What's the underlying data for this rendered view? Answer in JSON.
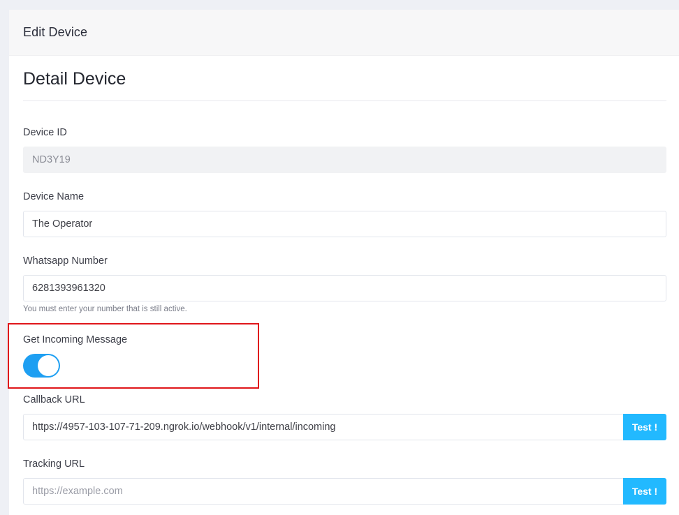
{
  "header": {
    "title": "Edit Device"
  },
  "section": {
    "title": "Detail Device"
  },
  "fields": {
    "device_id": {
      "label": "Device ID",
      "value": "ND3Y19"
    },
    "device_name": {
      "label": "Device Name",
      "value": "The Operator"
    },
    "whatsapp_number": {
      "label": "Whatsapp Number",
      "value": "6281393961320",
      "help": "You must enter your number that is still active."
    },
    "incoming_message": {
      "label": "Get Incoming Message",
      "enabled": true
    },
    "callback_url": {
      "label": "Callback URL",
      "value": "https://4957-103-107-71-209.ngrok.io/webhook/v1/internal/incoming",
      "button": "Test !"
    },
    "tracking_url": {
      "label": "Tracking URL",
      "value": "",
      "placeholder": "https://example.com",
      "button": "Test !"
    }
  },
  "colors": {
    "accent_toggle": "#1e9ff2",
    "button": "#22b9ff",
    "highlight": "#e0161a"
  }
}
